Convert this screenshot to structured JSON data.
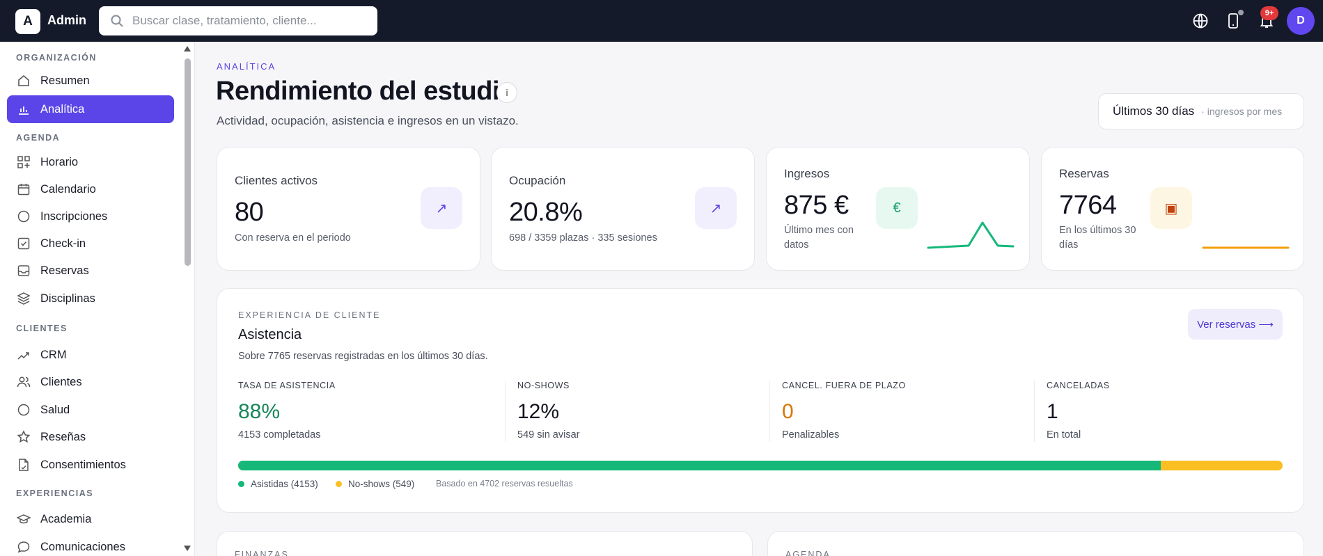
{
  "app": {
    "logo_letter": "A",
    "brand": "Admin",
    "avatar_initial": "D",
    "notifications_badge": "9+"
  },
  "search": {
    "placeholder": "Buscar clase, tratamiento, cliente..."
  },
  "sidebar": {
    "sections": [
      {
        "title": "ORGANIZACIÓN",
        "items": [
          {
            "label": "Resumen",
            "icon": "home-icon"
          },
          {
            "label": "Analítica",
            "icon": "bar-chart-icon",
            "active": true
          }
        ]
      },
      {
        "title": "AGENDA",
        "items": [
          {
            "label": "Horario",
            "icon": "grid-plus-icon"
          },
          {
            "label": "Calendario",
            "icon": "calendar-icon"
          },
          {
            "label": "Inscripciones",
            "icon": "circle-icon"
          },
          {
            "label": "Check-in",
            "icon": "checkbox-icon"
          },
          {
            "label": "Reservas",
            "icon": "inbox-icon"
          },
          {
            "label": "Disciplinas",
            "icon": "layers-icon"
          }
        ]
      },
      {
        "title": "CLIENTES",
        "items": [
          {
            "label": "CRM",
            "icon": "trend-icon"
          },
          {
            "label": "Clientes",
            "icon": "users-icon"
          },
          {
            "label": "Salud",
            "icon": "circle-icon"
          },
          {
            "label": "Reseñas",
            "icon": "star-icon"
          },
          {
            "label": "Consentimientos",
            "icon": "document-icon"
          }
        ]
      },
      {
        "title": "EXPERIENCIAS",
        "items": [
          {
            "label": "Academia",
            "icon": "graduation-cap-icon"
          },
          {
            "label": "Comunicaciones",
            "icon": "chat-bubble-icon"
          }
        ]
      }
    ]
  },
  "header": {
    "kicker": "ANALÍTICA",
    "title": "Rendimiento del estudio",
    "info": "i",
    "subtitle": "Actividad, ocupación, asistencia e ingresos en un vistazo.",
    "period_label": "Últimos 30 días",
    "period_note": "· ingresos por mes"
  },
  "kpis": [
    {
      "label": "Clientes activos",
      "value": "80",
      "sub": "Con reserva en el periodo",
      "icon": "arrow-up-right-icon",
      "icon_glyph": "↗"
    },
    {
      "label": "Ocupación",
      "value": "20.8%",
      "sub": "698 / 3359 plazas · 335 sesiones",
      "icon": "arrow-up-right-icon",
      "icon_glyph": "↗"
    },
    {
      "label": "Ingresos",
      "value": "875 €",
      "sub": "Último mes con datos",
      "icon": "euro-icon",
      "icon_glyph": "€"
    },
    {
      "label": "Reservas",
      "value": "7764",
      "sub": "En los últimos 30 días",
      "icon": "box-icon",
      "icon_glyph": "▣"
    }
  ],
  "attendance": {
    "kicker": "EXPERIENCIA DE CLIENTE",
    "title": "Asistencia",
    "subtitle": "Sobre 7765 reservas registradas en los últimos 30 días.",
    "button": "Ver reservas ⟶",
    "stats": [
      {
        "label": "TASA DE ASISTENCIA",
        "value": "88%",
        "sub": "4153 completadas",
        "color": "#15875a"
      },
      {
        "label": "NO-SHOWS",
        "value": "12%",
        "sub": "549 sin avisar",
        "color": "#121420"
      },
      {
        "label": "CANCEL. FUERA DE PLAZO",
        "value": "0",
        "sub": "Penalizables",
        "color": "#d97706"
      },
      {
        "label": "CANCELADAS",
        "value": "1",
        "sub": "En total",
        "color": "#121420"
      }
    ],
    "bar": {
      "attended_fraction": 0.883,
      "attended_color": "#16b87a",
      "noshow_color": "#fbbf24"
    },
    "legend": {
      "attended": "Asistidas (4153)",
      "noshows": "No-shows (549)",
      "note": "Basado en 4702 reservas resueltas"
    }
  },
  "bottom": {
    "left_kicker": "FINANZAS",
    "right_kicker": "AGENDA"
  },
  "colors": {
    "accent": "#5b45e8",
    "topbar": "#151a2b",
    "success": "#16b87a",
    "warning": "#fbbf24"
  }
}
